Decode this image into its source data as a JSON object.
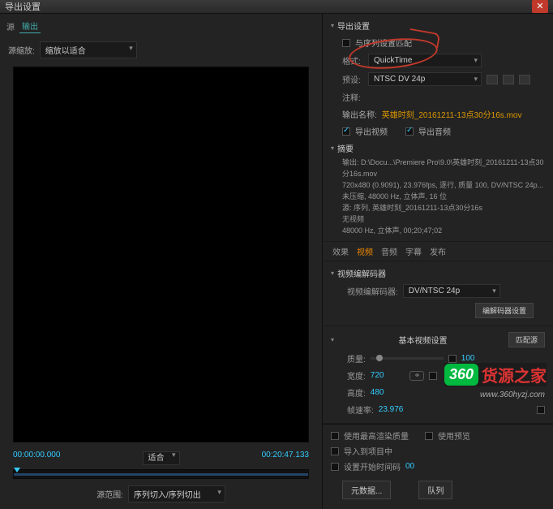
{
  "window": {
    "title": "导出设置"
  },
  "left": {
    "tabs": {
      "source": "源",
      "output": "输出"
    },
    "preset_label": "源缩放:",
    "preset_value": "缩放以适合",
    "time_in": "00:00:00.000",
    "fit_label": "适合",
    "time_dur": "00:20:47.133",
    "range_label": "源范围:",
    "range_value": "序列切入/序列切出"
  },
  "export": {
    "header": "导出设置",
    "match_label": "与序列设置匹配",
    "format_label": "格式:",
    "format_value": "QuickTime",
    "preset_label": "预设:",
    "preset_value": "NTSC DV 24p",
    "comment_label": "注释:",
    "outname_label": "输出名称:",
    "outname_value": "英雄时刻_20161211-13点30分16s.mov",
    "export_video": "导出视频",
    "export_audio": "导出音频"
  },
  "summary": {
    "header": "摘要",
    "out_label": "输出:",
    "out_l1": "D:\\Docu...\\Premiere Pro\\9.0\\英雄时刻_20161211-13点30分16s.mov",
    "out_l2": "720x480 (0.9091), 23.976fps, 逐行, 质量 100, DV/NTSC 24p...",
    "out_l3": "未压缩, 48000 Hz, 立体声, 16 位",
    "src_label": "源:",
    "src_l1": "序列, 英雄时刻_20161211-13点30分16s",
    "src_l2": "无视频",
    "src_l3": "48000 Hz, 立体声, 00;20;47;02"
  },
  "tabs": {
    "effects": "效果",
    "video": "视频",
    "audio": "音频",
    "captions": "字幕",
    "publish": "发布"
  },
  "video": {
    "codec_header": "视频编解码器",
    "codec_label": "视频编解码器:",
    "codec_value": "DV/NTSC 24p",
    "codec_btn": "编解码器设置",
    "basic_header": "基本视频设置",
    "match_btn": "匹配源",
    "quality": "质量:",
    "quality_val": "100",
    "width": "宽度:",
    "width_val": "720",
    "height": "高度:",
    "height_val": "480",
    "fps": "帧速率:",
    "fps_val": "23.976"
  },
  "footer": {
    "max_render": "使用最高渲染质量",
    "use_prev": "使用预览",
    "import_proj": "导入到项目中",
    "set_tc": "设置开始时间码",
    "tc_val": "00",
    "metadata_btn": "元数据...",
    "queue_btn": "队列"
  },
  "watermark": {
    "badge": "360",
    "text": "货源之家",
    "url": "www.360hyzj.com"
  }
}
